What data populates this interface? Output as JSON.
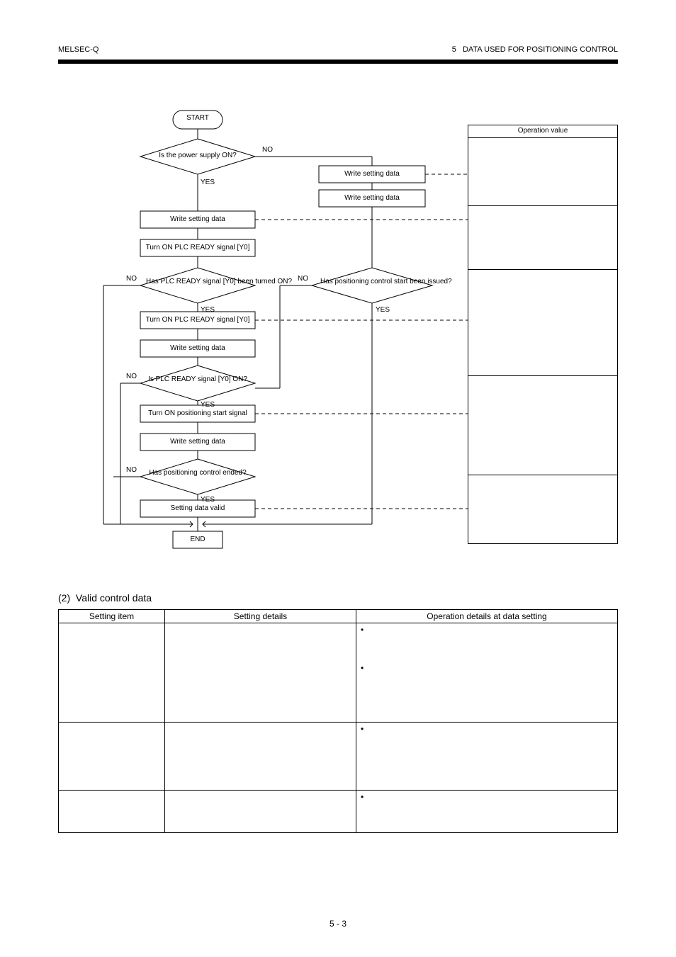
{
  "header": {
    "left": "MELSEC-Q",
    "right": "5   DATA USED FOR POSITIONING CONTROL"
  },
  "flow": {
    "start": "START",
    "d_power": "Is the power supply ON?",
    "power_yes": "YES",
    "power_no": "NO",
    "box_poweroff1": "Write setting data",
    "box_poweroff2": "Write setting data",
    "box_plcready1": "Turn ON PLC READY signal [Y0]",
    "box_set1": "Write setting data",
    "d_ready1": "Has PLC READY signal [Y0] been turned ON?",
    "ready_yes": "YES",
    "ready_no": "NO",
    "box_req1_1": "Turn ON PLC READY signal [Y0]",
    "box_req1_2": "Write setting data",
    "d_ready2": "Is PLC READY signal [Y0] ON?",
    "ready2_yes": "YES",
    "ready2_no": "NO",
    "d_right": "Has positioning control start been issued?",
    "right_yes": "YES",
    "right_no": "NO",
    "box_posstart1": "Turn ON positioning start signal",
    "box_posstart2": "Write setting data",
    "d_posend": "Has positioning control ended?",
    "posend_yes": "YES",
    "posend_no": "NO",
    "box_end": "Setting data valid",
    "end": "END"
  },
  "sidetable": {
    "header": "Operation value",
    "rows": [
      "",
      "",
      "",
      "",
      ""
    ]
  },
  "subsection1": "(2)  Valid control data",
  "maintable": {
    "headers": [
      "Setting item",
      "Setting details",
      "Operation details at data setting"
    ],
    "rows": [
      {
        "item": "",
        "details": "",
        "ops": [
          "",
          ""
        ]
      },
      {
        "item": "",
        "details": "",
        "ops": [
          ""
        ]
      },
      {
        "item": "",
        "details": "",
        "ops": [
          ""
        ]
      }
    ]
  },
  "page_number": "5 - 3"
}
